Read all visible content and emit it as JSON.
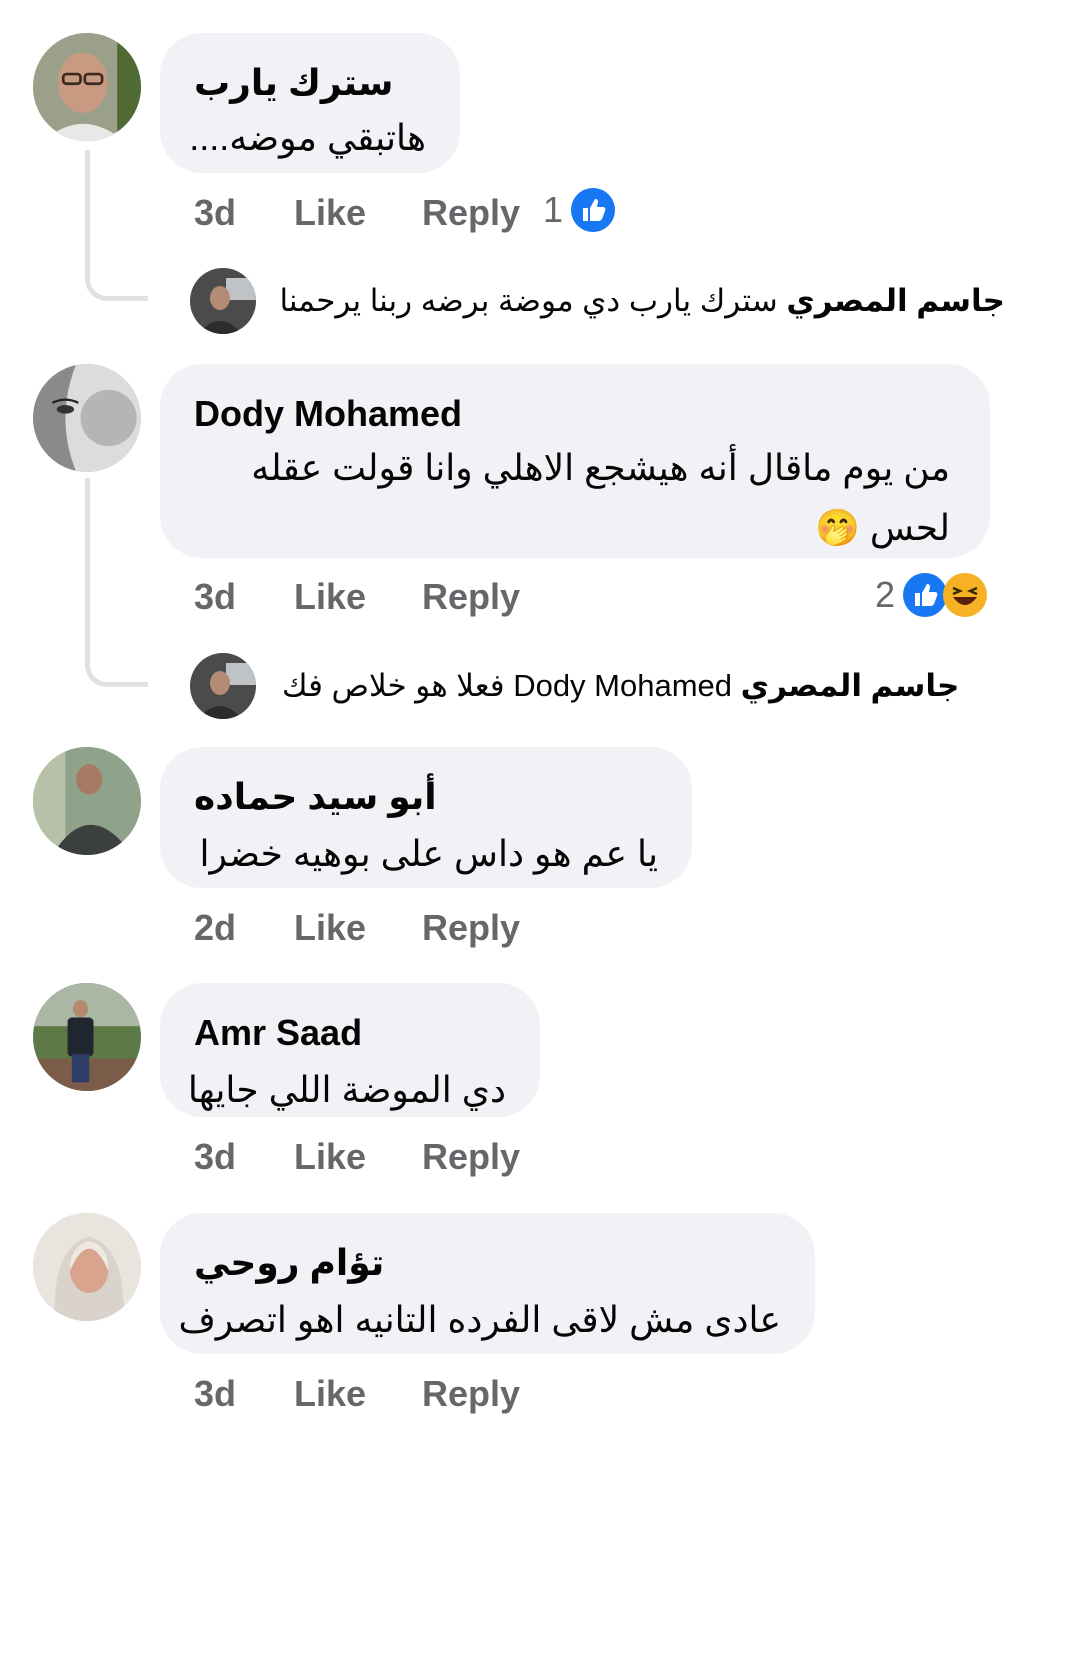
{
  "labels": {
    "like": "Like",
    "reply": "Reply"
  },
  "comments": [
    {
      "author": "سترك يارب",
      "text": "هاتبقي موضه....",
      "time": "3d",
      "reaction_count": "1",
      "reactions": [
        "like"
      ],
      "avatar": "avatar-man-glasses",
      "reply": {
        "author": "جاسم المصري",
        "text": "سترك يارب دي موضة برضه ربنا يرحمنا",
        "avatar": "avatar-man-car"
      }
    },
    {
      "author": "Dody Mohamed",
      "text": "من يوم ماقال أنه هيشجع الاهلي وانا قولت عقله لحس",
      "emoji": "🤭",
      "time": "3d",
      "reaction_count": "2",
      "reactions": [
        "like",
        "haha"
      ],
      "avatar": "avatar-woman-drawing",
      "reply": {
        "author": "جاسم المصري",
        "mention": "Dody Mohamed",
        "text": "فعلا هو خلاص فك",
        "avatar": "avatar-man-car"
      }
    },
    {
      "author": "أبو سيد حماده",
      "text": "يا عم هو داس على بوهيه خضرا",
      "time": "2d",
      "avatar": "avatar-man-sitting"
    },
    {
      "author": "Amr Saad",
      "text": "دي الموضة اللي جايها",
      "time": "3d",
      "avatar": "avatar-man-garden"
    },
    {
      "author": "تؤام روحي",
      "text": "عادى مش لاقى الفرده التانيه اهو اتصرف",
      "time": "3d",
      "avatar": "avatar-woman-hijab"
    }
  ],
  "colors": {
    "bubble": "#f0f2f5",
    "meta": "#65676b",
    "like_blue": "#1877f2",
    "haha_yellow": "#f7b125"
  }
}
